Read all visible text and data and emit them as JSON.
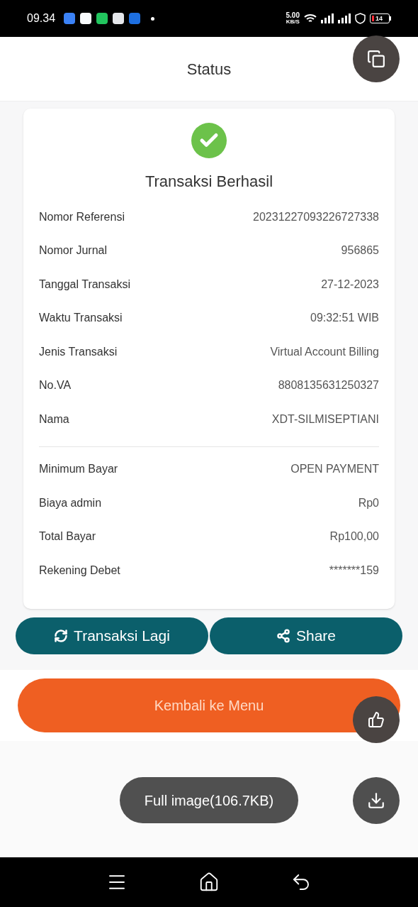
{
  "status_bar": {
    "time": "09.34",
    "speed_value": "5.00",
    "speed_unit": "KB/S",
    "battery": "14"
  },
  "header": {
    "title": "Status"
  },
  "receipt": {
    "title": "Transaksi Berhasil",
    "sections": [
      [
        {
          "label": "Nomor Referensi",
          "value": "20231227093226727338"
        },
        {
          "label": "Nomor Jurnal",
          "value": "956865"
        },
        {
          "label": "Tanggal Transaksi",
          "value": "27-12-2023"
        },
        {
          "label": "Waktu Transaksi",
          "value": "09:32:51 WIB"
        },
        {
          "label": "Jenis Transaksi",
          "value": "Virtual Account Billing"
        },
        {
          "label": "No.VA",
          "value": "8808135631250327"
        },
        {
          "label": "Nama",
          "value": "XDT-SILMISEPTIANI"
        }
      ],
      [
        {
          "label": "Minimum Bayar",
          "value": "OPEN PAYMENT"
        },
        {
          "label": "Biaya admin",
          "value": "Rp0"
        },
        {
          "label": "Total Bayar",
          "value": "Rp100,00"
        },
        {
          "label": "Rekening Debet",
          "value": "*******159"
        }
      ]
    ]
  },
  "actions": [
    {
      "label": "Transaksi Lagi",
      "kind": "repeat"
    },
    {
      "label": "Share",
      "kind": "share"
    }
  ],
  "main_button": {
    "label": "Kembali ke Menu"
  },
  "viewer": {
    "toast": "Full image(106.7KB)"
  }
}
